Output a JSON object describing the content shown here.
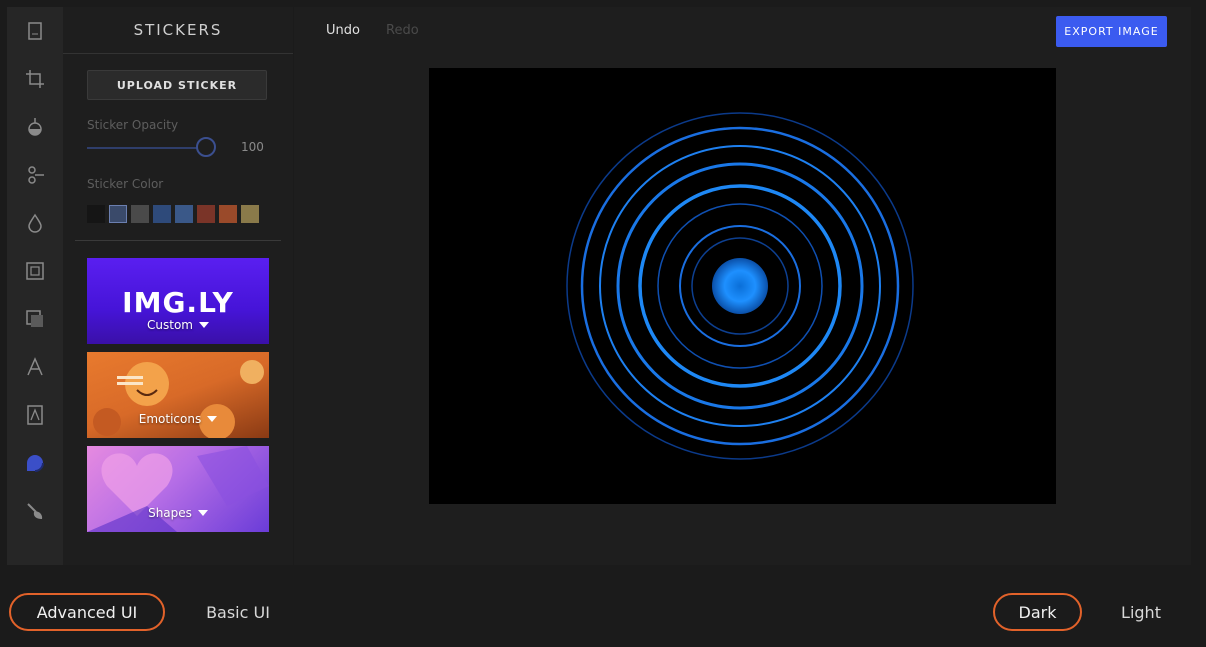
{
  "panel": {
    "title": "STICKERS",
    "upload_label": "UPLOAD STICKER",
    "opacity_label": "Sticker Opacity",
    "opacity_value": "100",
    "color_label": "Sticker Color",
    "swatches": [
      "#151515",
      "#3a4a6a",
      "#4a4a4a",
      "#2e4a7a",
      "#3a5888",
      "#7a3428",
      "#9a4a2a",
      "#8a7a4a"
    ],
    "categories": [
      {
        "label": "Custom",
        "logo": "IMG.LY"
      },
      {
        "label": "Emoticons"
      },
      {
        "label": "Shapes"
      }
    ]
  },
  "toolbar": {
    "undo_label": "Undo",
    "redo_label": "Redo",
    "export_label": "EXPORT IMAGE"
  },
  "bottom": {
    "advanced_label": "Advanced UI",
    "basic_label": "Basic UI",
    "dark_label": "Dark",
    "light_label": "Light"
  },
  "colors": {
    "accent": "#3b5bf0",
    "active_outline": "#e2622a"
  }
}
